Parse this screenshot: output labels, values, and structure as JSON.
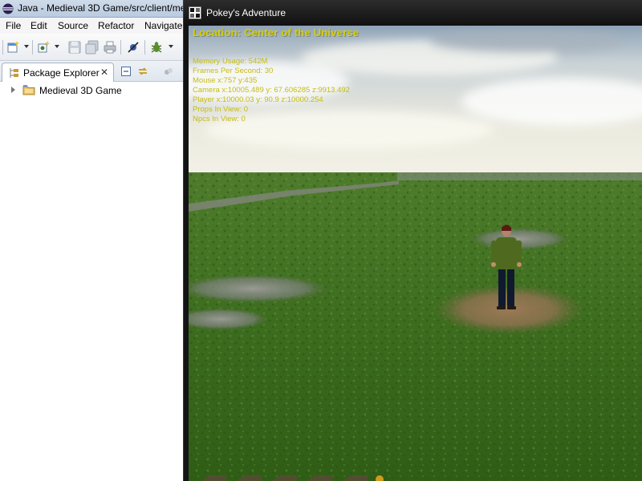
{
  "eclipse": {
    "title": "Java - Medieval 3D Game/src/client/me",
    "menu": [
      "File",
      "Edit",
      "Source",
      "Refactor",
      "Navigate"
    ],
    "toolbar_icons": [
      "new-wizard-icon",
      "new-type-icon",
      "save-icon",
      "save-all-icon",
      "print-icon",
      "skip-breakpoints-icon",
      "debug-icon"
    ],
    "package_explorer": {
      "tab_label": "Package Explorer",
      "close_glyph": "✕",
      "tree": [
        {
          "label": "Medieval 3D Game",
          "type": "project",
          "expanded": false
        }
      ]
    }
  },
  "game": {
    "window_title": "Pokey's Adventure",
    "hud": {
      "location": "Location: Center of the Universe",
      "stats": [
        "Memory Usage: 542M",
        "Frames Per Second: 30",
        "Mouse x:757 y:435",
        "Camera x:10005.489 y: 67.606285 z:9913.492",
        "Player x:10000.03 y: 90.9 z:10000.254",
        "Props In View: 0",
        "Npcs In View: 0"
      ]
    }
  },
  "colors": {
    "hud_text": "#d8d000",
    "grass": "#3e6e1f",
    "game_titlebar": "#1a1a1a"
  }
}
